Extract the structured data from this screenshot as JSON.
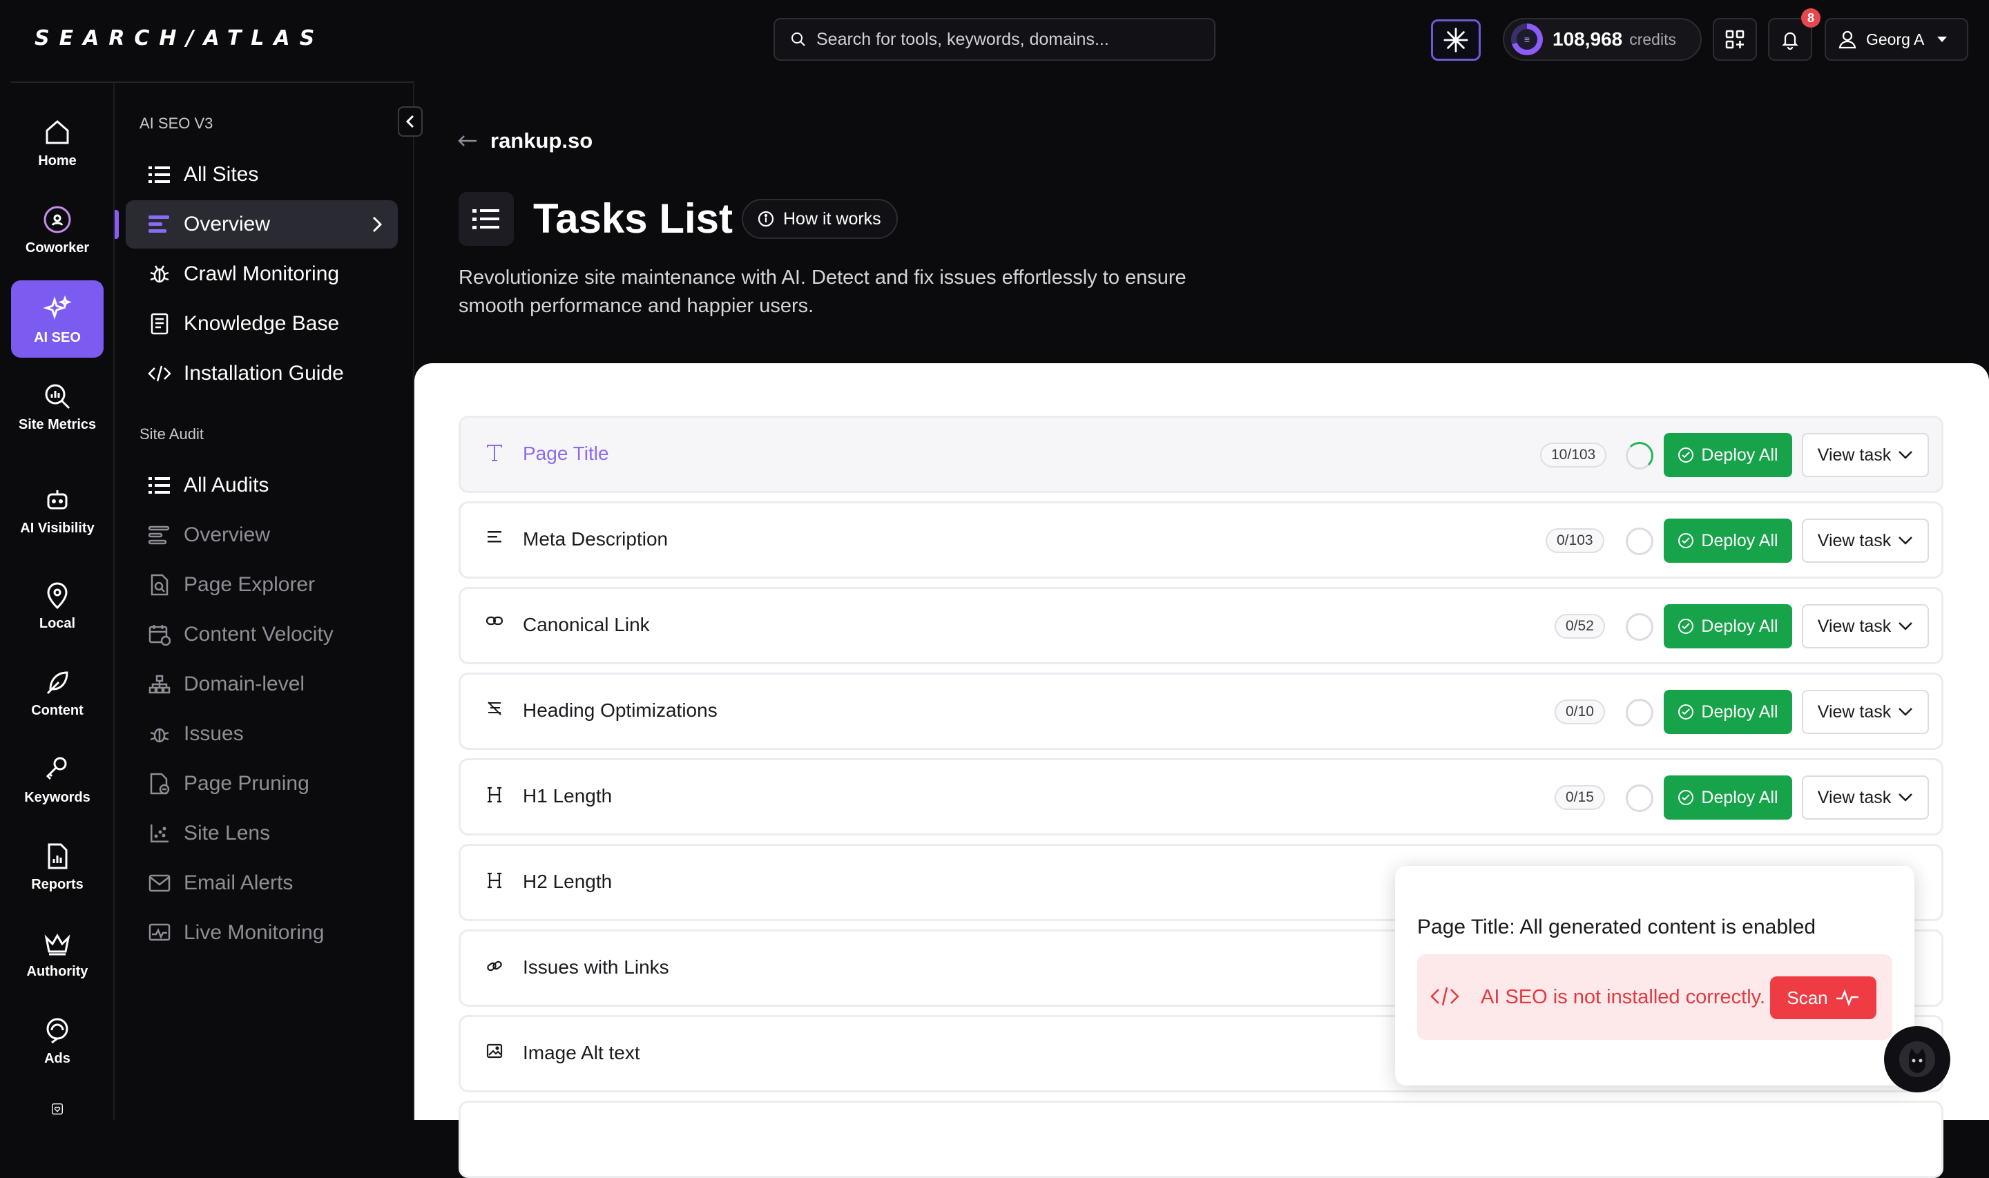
{
  "header": {
    "logo": "SEARCH/ATLAS",
    "search_placeholder": "Search for tools, keywords, domains...",
    "credits_value": "108,968",
    "credits_label": "credits",
    "notifications_count": "8",
    "user_name": "Georg A"
  },
  "rail": [
    {
      "label": "Home",
      "icon": "home-icon"
    },
    {
      "label": "Coworker",
      "icon": "coworker-icon"
    },
    {
      "label": "AI SEO",
      "icon": "sparkles-icon",
      "active": true
    },
    {
      "label": "Site Metrics",
      "icon": "magnifier-chart-icon"
    },
    {
      "label": "AI Visibility",
      "icon": "robot-icon"
    },
    {
      "label": "Local",
      "icon": "map-pin-icon"
    },
    {
      "label": "Content",
      "icon": "feather-icon"
    },
    {
      "label": "Keywords",
      "icon": "key-icon"
    },
    {
      "label": "Reports",
      "icon": "report-icon"
    },
    {
      "label": "Authority",
      "icon": "crown-icon"
    },
    {
      "label": "Ads",
      "icon": "ads-icon"
    }
  ],
  "sidebar": {
    "section1": "AI SEO V3",
    "items1": [
      {
        "label": "All Sites",
        "icon": "list-icon"
      },
      {
        "label": "Overview",
        "icon": "overview-icon",
        "active": true
      },
      {
        "label": "Crawl Monitoring",
        "icon": "bug-icon"
      },
      {
        "label": "Knowledge Base",
        "icon": "book-icon"
      },
      {
        "label": "Installation Guide",
        "icon": "code-icon"
      }
    ],
    "section2": "Site Audit",
    "items2": [
      {
        "label": "All Audits",
        "icon": "list-icon"
      },
      {
        "label": "Overview",
        "icon": "overview-icon"
      },
      {
        "label": "Page Explorer",
        "icon": "page-search-icon"
      },
      {
        "label": "Content Velocity",
        "icon": "calendar-icon"
      },
      {
        "label": "Domain-level",
        "icon": "sitemap-icon"
      },
      {
        "label": "Issues",
        "icon": "bug-icon"
      },
      {
        "label": "Page Pruning",
        "icon": "page-minus-icon"
      },
      {
        "label": "Site Lens",
        "icon": "scatter-icon"
      },
      {
        "label": "Email Alerts",
        "icon": "mail-icon"
      },
      {
        "label": "Live Monitoring",
        "icon": "monitor-icon"
      }
    ]
  },
  "main": {
    "breadcrumb": "rankup.so",
    "title": "Tasks List",
    "how_it_works": "How it works",
    "description": "Revolutionize site maintenance with AI. Detect and fix issues effortlessly to ensure smooth performance and happier users.",
    "deploy_label": "Deploy All",
    "view_label": "View task",
    "tasks": [
      {
        "name": "Page Title",
        "count": "10/103",
        "icon": "text-t-icon",
        "highlighted": true
      },
      {
        "name": "Meta Description",
        "count": "0/103",
        "icon": "align-left-icon"
      },
      {
        "name": "Canonical Link",
        "count": "0/52",
        "icon": "link-icon"
      },
      {
        "name": "Heading Optimizations",
        "count": "0/10",
        "icon": "strikethrough-icon"
      },
      {
        "name": "H1 Length",
        "count": "0/15",
        "icon": "heading-icon"
      },
      {
        "name": "H2 Length",
        "icon": "heading-icon"
      },
      {
        "name": "Issues with Links",
        "icon": "chain-icon"
      },
      {
        "name": "Image Alt text",
        "icon": "image-icon"
      }
    ]
  },
  "popup": {
    "title": "Page Title: All generated content is enabled",
    "alert_text": "AI SEO is not installed correctly.",
    "scan_label": "Scan"
  },
  "colors": {
    "accent": "#7c5cf0",
    "deploy_green": "#16a34a",
    "alert_red": "#ef3b43"
  }
}
